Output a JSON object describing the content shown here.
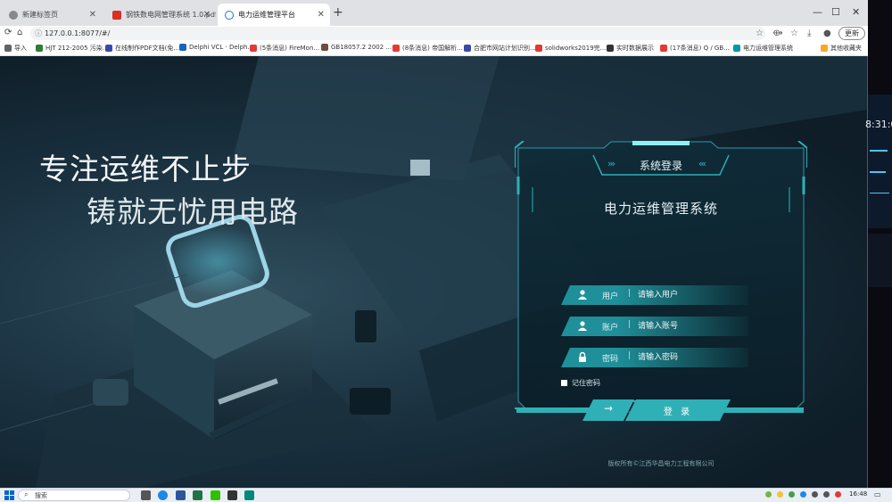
{
  "browser": {
    "tabs": [
      {
        "title": "新建标签页",
        "icon_color": "#888888"
      },
      {
        "title": "钢铁数电网管理系统 1.0.pdf",
        "icon_color": "#d93025"
      },
      {
        "title": "电力运维管理平台",
        "icon_color": "#1a73e8"
      }
    ],
    "url": "127.0.0.1:8077/#/",
    "update_label": "更新",
    "bookmarks": [
      {
        "label": "导入",
        "color": "#5f6368"
      },
      {
        "label": "HJT 212-2005 污染...",
        "color": "#2e7d32"
      },
      {
        "label": "在线制作PDF文档(免...",
        "color": "#3949ab"
      },
      {
        "label": "Delphi VCL · Delph...",
        "color": "#1565c0"
      },
      {
        "label": "(5条消息) FireMon...",
        "color": "#e53935"
      },
      {
        "label": "GB18057.2 2002 ...",
        "color": "#6d4c41"
      },
      {
        "label": "(8条消息) 帝国解析...",
        "color": "#e53935"
      },
      {
        "label": "合肥市网站计划识别...",
        "color": "#3949ab"
      },
      {
        "label": "solidworks2019完...",
        "color": "#e53935"
      },
      {
        "label": "实时数据展示",
        "color": "#333333"
      },
      {
        "label": "(17条消息) Q / GB...",
        "color": "#e53935"
      },
      {
        "label": "电力运维管理系统",
        "color": "#0097a7"
      },
      {
        "label": "其他收藏夹",
        "color": "#f9a825"
      }
    ]
  },
  "page": {
    "slogan_line1": "专注运维不止步",
    "slogan_line2": "铸就无忧用电路",
    "panel": {
      "title": "系统登录",
      "system_name": "电力运维管理系统",
      "fields": [
        {
          "icon": "user-icon",
          "label": "用户",
          "separator": "|",
          "placeholder": "请输入用户"
        },
        {
          "icon": "account-icon",
          "label": "账户",
          "separator": "|",
          "placeholder": "请输入账号"
        },
        {
          "icon": "lock-icon",
          "label": "密码",
          "separator": "|",
          "placeholder": "请输入密码"
        }
      ],
      "remember_label": "记住密码",
      "arrow_label": "→",
      "login_label": "登 录",
      "copyright": "版权所有©江西华昌电力工程有限公司",
      "accent_color": "#2fb0b6"
    }
  },
  "desktop": {
    "clock_fragment": "8:31:0"
  },
  "taskbar": {
    "search_placeholder": "搜索",
    "time": "16:48"
  }
}
